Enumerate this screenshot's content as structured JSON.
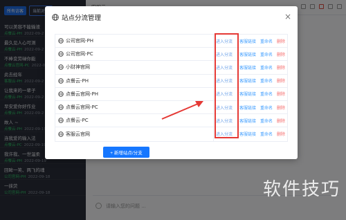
{
  "background": {
    "tabs": [
      "所有访客",
      "当前对话"
    ],
    "conversations": [
      {
        "message": "可以美容不能输液",
        "source": "点餐云-PH",
        "time": "2022-09-2"
      },
      {
        "message": "最久见人心可测",
        "source": "点餐云-PH",
        "time": "2022-09-2"
      },
      {
        "message": "不棒变劳碌你能",
        "source": "点餐云官网-PC",
        "time": "2022-09"
      },
      {
        "message": "此去经年",
        "source": "客服云-PH",
        "time": "2022-09-2"
      },
      {
        "message": "让我来的一辈子",
        "source": "点餐云-PH",
        "time": "2022-09-2"
      },
      {
        "message": "早安爱你好作业",
        "source": "点餐云-PH",
        "time": "2022-09-2"
      },
      {
        "message": "故人 ~",
        "source": "点餐云-PH",
        "time": "2022-09-19"
      },
      {
        "message": "连我爱的输入法",
        "source": "点餐云-PC",
        "time": "2022-09-19"
      },
      {
        "message": "我许我、一世温柔",
        "source": "点餐云-PH",
        "time": "2022-09-19"
      },
      {
        "message": "回眸一笑、两飞的魂",
        "source": "公司官网-PH",
        "time": "2022-09-18"
      },
      {
        "message": "一抹荧",
        "source": "公司官网-PH",
        "time": "2022-09-18"
      }
    ],
    "chat_header": "客服云",
    "input_placeholder": "请输入您的问题 ..."
  },
  "dialog": {
    "title": "站点分流管理",
    "close_label": "×",
    "sites": [
      {
        "name": "公司官网-PH"
      },
      {
        "name": "公司官网-PC"
      },
      {
        "name": "小财神官网"
      },
      {
        "name": "点餐云-PH"
      },
      {
        "name": "点餐云官网-PH"
      },
      {
        "name": "点餐云官网-PC"
      },
      {
        "name": "点餐云-PC"
      },
      {
        "name": "客服云官网"
      }
    ],
    "actions": {
      "enter": "进入分流",
      "edit": "客服链接",
      "rename": "重命名",
      "delete": "删除"
    },
    "add_button": "+ 新增站点/分支"
  },
  "watermark": "软件技巧",
  "colors": {
    "primary": "#1677ff",
    "highlight": "#e53935",
    "danger": "#f56c6c"
  }
}
